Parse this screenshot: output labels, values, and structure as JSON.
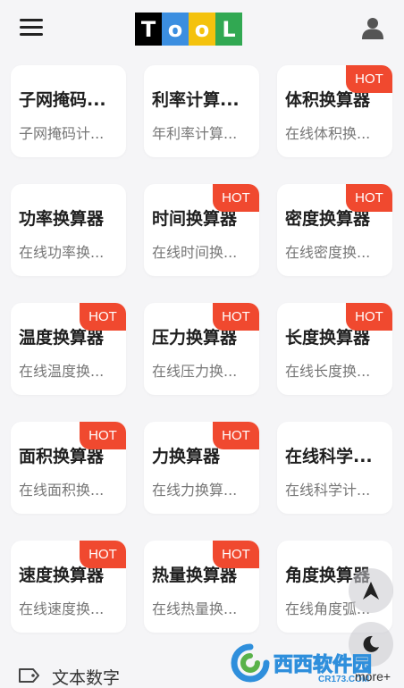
{
  "header": {
    "logo_letters": [
      {
        "char": "T",
        "bg": "#000000",
        "fg": "#ffffff"
      },
      {
        "char": "o",
        "bg": "#3b8ee0",
        "fg": "#ffffff"
      },
      {
        "char": "o",
        "bg": "#f4c20d",
        "fg": "#ffffff"
      },
      {
        "char": "L",
        "bg": "#31a852",
        "fg": "#ffffff"
      }
    ]
  },
  "tools": [
    {
      "title": "子网掩码...",
      "desc": "子网掩码计...",
      "hot": false
    },
    {
      "title": "利率计算...",
      "desc": "年利率计算...",
      "hot": false
    },
    {
      "title": "体积换算器",
      "desc": "在线体积换...",
      "hot": true
    },
    {
      "title": "功率换算器",
      "desc": "在线功率换...",
      "hot": false
    },
    {
      "title": "时间换算器",
      "desc": "在线时间换...",
      "hot": true
    },
    {
      "title": "密度换算器",
      "desc": "在线密度换...",
      "hot": true
    },
    {
      "title": "温度换算器",
      "desc": "在线温度换...",
      "hot": true
    },
    {
      "title": "压力换算器",
      "desc": "在线压力换...",
      "hot": true
    },
    {
      "title": "长度换算器",
      "desc": "在线长度换...",
      "hot": true
    },
    {
      "title": "面积换算器",
      "desc": "在线面积换...",
      "hot": true
    },
    {
      "title": "力换算器",
      "desc": "在线力换算...",
      "hot": true
    },
    {
      "title": "在线科学...",
      "desc": "在线科学计...",
      "hot": false
    },
    {
      "title": "速度换算器",
      "desc": "在线速度换...",
      "hot": true
    },
    {
      "title": "热量换算器",
      "desc": "在线热量换...",
      "hot": true
    },
    {
      "title": "角度换算器",
      "desc": "在线角度弧...",
      "hot": false
    }
  ],
  "hot_label": "HOT",
  "section": {
    "label": "文本数字"
  },
  "more_label": "more+",
  "watermark": {
    "text": "西西软件园",
    "sub": "CR173.COM"
  },
  "colors": {
    "hot": "#f0492f",
    "background": "#f5f5f7"
  }
}
